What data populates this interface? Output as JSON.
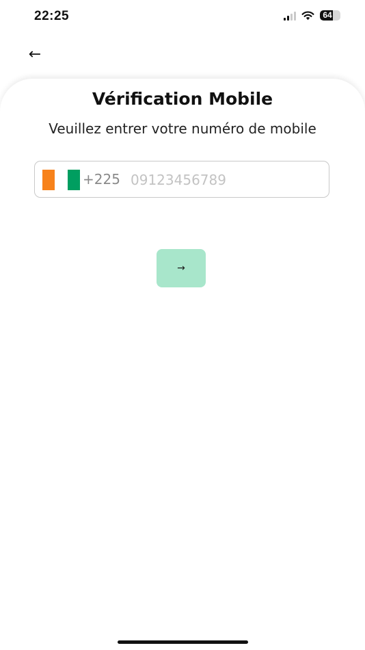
{
  "status_bar": {
    "time": "22:25",
    "battery_level": "64",
    "icons": [
      "signal-icon",
      "wifi-icon",
      "battery-icon"
    ]
  },
  "header": {
    "back_label": "←"
  },
  "main": {
    "title": "Vérification Mobile",
    "subtitle": "Veuillez entrer votre numéro de mobile",
    "phone": {
      "country_code": "+225",
      "value": "",
      "placeholder": "09123456789",
      "flag_colors": [
        "#f7821b",
        "#ffffff",
        "#009e60"
      ]
    },
    "next_label": "→"
  },
  "colors": {
    "next_button_bg": "#a8e6cb",
    "text": "#111111"
  }
}
